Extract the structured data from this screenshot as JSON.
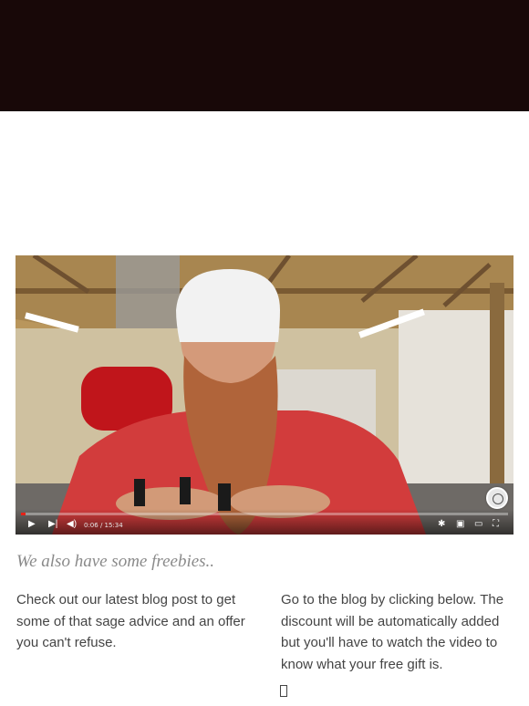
{
  "video": {
    "time_display": "0:06 / 15:34",
    "progress_fraction": 0.0064,
    "icons": {
      "play": "play-icon",
      "next": "next-icon",
      "volume": "volume-icon",
      "settings": "gear-icon",
      "miniplayer": "miniplayer-icon",
      "theater": "theater-icon",
      "fullscreen": "fullscreen-icon"
    }
  },
  "content": {
    "heading": "We also have some freebies..",
    "left_text": "Check out our latest blog post to get some of that sage advice and an offer you can't refuse.",
    "right_text": "Go to the blog by clicking below. The discount will be automatically added but you'll have to watch the video to know what your free gift is."
  },
  "colors": {
    "top_bar": "#180808",
    "progress": "#e62117",
    "heading": "#8a8a8a",
    "body_text": "#444444"
  }
}
